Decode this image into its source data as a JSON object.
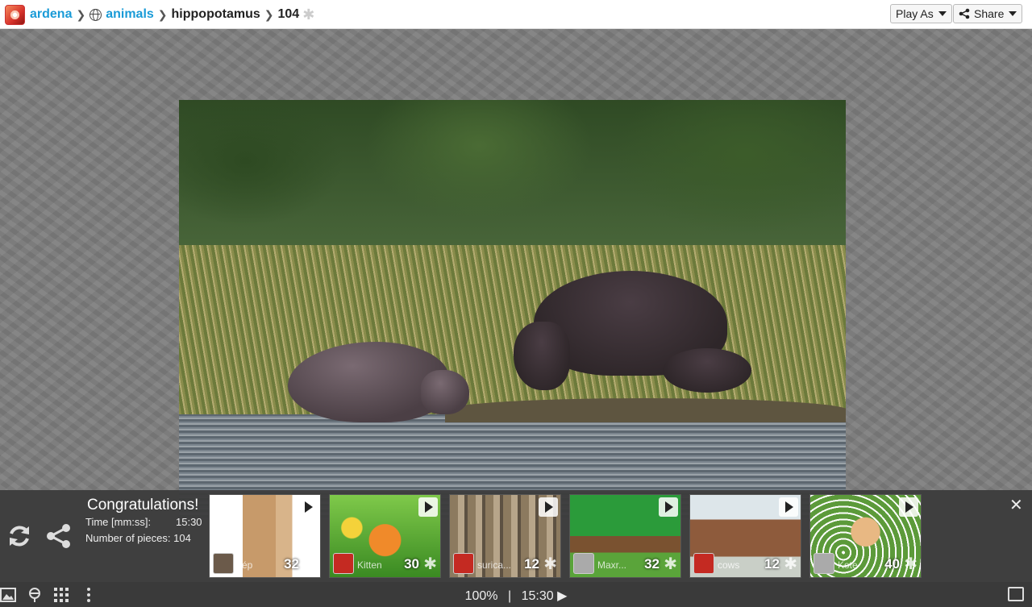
{
  "breadcrumb": {
    "user": "ardena",
    "category": "animals",
    "puzzle": "hippopotamus",
    "pieces": "104"
  },
  "header": {
    "play_as_label": "Play As",
    "share_label": "Share"
  },
  "panel": {
    "title": "Congratulations!",
    "time_label": "Time [mm:ss]:",
    "time_value": "15:30",
    "pieces_label": "Number of pieces: 104",
    "thumbnails": [
      {
        "name": "kép",
        "count": "32"
      },
      {
        "name": "Kitten",
        "count": "30"
      },
      {
        "name": "surica...",
        "count": "12"
      },
      {
        "name": "Maxr...",
        "count": "32"
      },
      {
        "name": "cows",
        "count": "12"
      },
      {
        "name": "Kote",
        "count": "40"
      }
    ]
  },
  "status": {
    "zoom": "100%",
    "time": "15:30"
  }
}
